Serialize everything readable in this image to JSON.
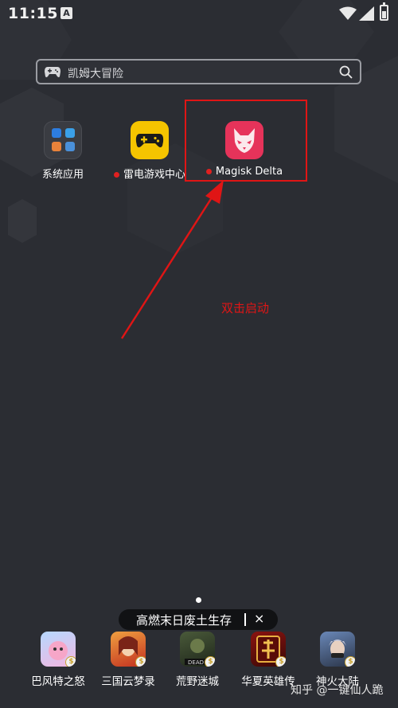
{
  "status_bar": {
    "time": "11:15",
    "notification_icon": "a-notification-icon",
    "icons": [
      "wifi-icon",
      "signal-icon",
      "battery-icon"
    ]
  },
  "search": {
    "icon": "gamepad-icon",
    "text": "凯姆大冒险",
    "action_icon": "search-icon"
  },
  "apps": [
    {
      "label": "系统应用",
      "icon": "folder-icon",
      "new_dot": false
    },
    {
      "label": "雷电游戏中心",
      "icon": "gamepad-icon",
      "new_dot": true
    },
    {
      "label": "Magisk Delta",
      "icon": "fox-icon",
      "new_dot": true
    }
  ],
  "annotation": {
    "text": "双击启动",
    "color": "#e01515"
  },
  "banner": {
    "text": "高燃末日废土生存",
    "close": "×"
  },
  "dock": [
    {
      "label": "巴风特之怒"
    },
    {
      "label": "三国云梦录"
    },
    {
      "label": "荒野迷城"
    },
    {
      "label": "华夏英雄传"
    },
    {
      "label": "神火大陆"
    }
  ],
  "watermark": "知乎 @一键仙人跪",
  "colors": {
    "background": "#2b2d33",
    "accent_red": "#e01515",
    "game_center_yellow": "#f5c400",
    "magisk_pink": "#e6335a"
  }
}
